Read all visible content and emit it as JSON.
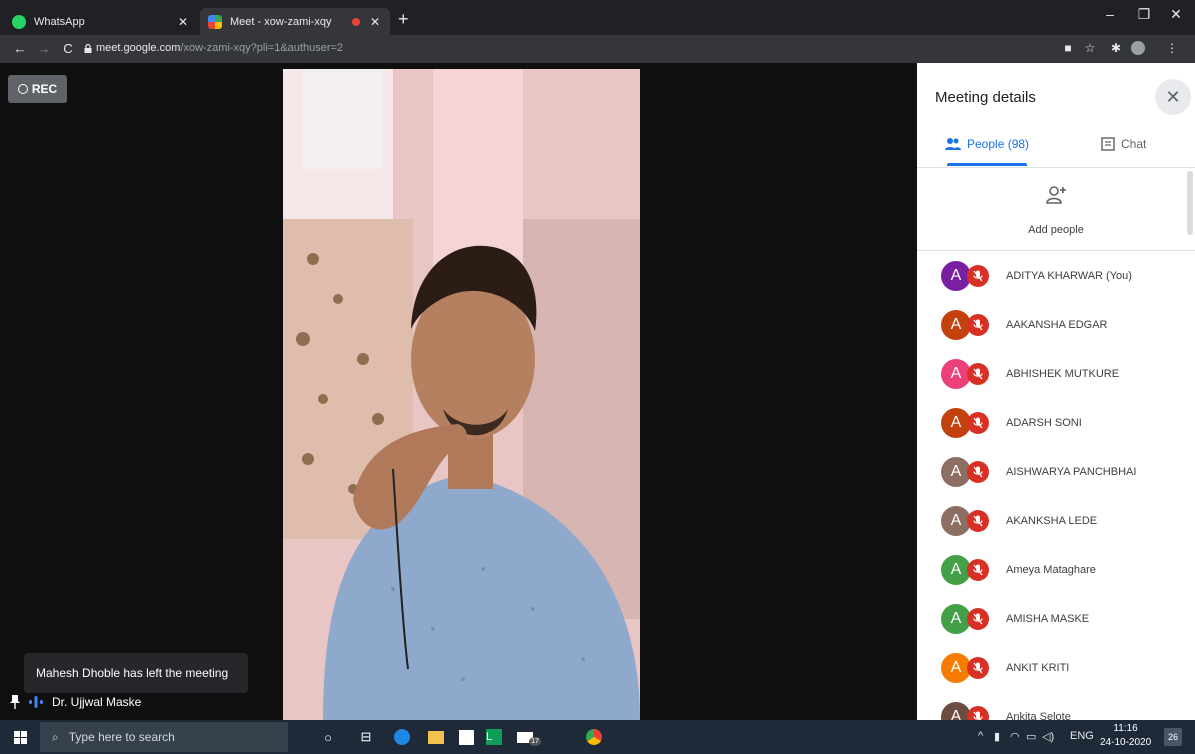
{
  "browser": {
    "tabs": [
      {
        "title": "WhatsApp"
      },
      {
        "title": "Meet - xow-zami-xqy"
      }
    ],
    "url_host": "meet.google.com",
    "url_path": "/xow-zami-xqy?pli=1&authuser=2"
  },
  "meeting": {
    "rec_label": "REC",
    "toast": "Mahesh Dhoble has left the meeting",
    "speaker_name": "Dr. Ujjwal Maske"
  },
  "panel": {
    "title": "Meeting details",
    "people_tab": "People (98)",
    "chat_tab": "Chat",
    "add_people": "Add people",
    "participants": [
      {
        "initial": "A",
        "name": "ADITYA KHARWAR (You)",
        "color": "#7b1fa2"
      },
      {
        "initial": "A",
        "name": "AAKANSHA EDGAR",
        "color": "#c2410c"
      },
      {
        "initial": "A",
        "name": "ABHISHEK MUTKURE",
        "color": "#ec407a"
      },
      {
        "initial": "A",
        "name": "ADARSH SONI",
        "color": "#c2410c"
      },
      {
        "initial": "A",
        "name": "AISHWARYA PANCHBHAI",
        "color": "#8d6e63"
      },
      {
        "initial": "A",
        "name": "AKANKSHA LEDE",
        "color": "#8d6e63"
      },
      {
        "initial": "A",
        "name": "Ameya Mataghare",
        "color": "#43a047"
      },
      {
        "initial": "A",
        "name": "AMISHA MASKE",
        "color": "#43a047"
      },
      {
        "initial": "A",
        "name": "ANKIT KRITI",
        "color": "#f57c00"
      },
      {
        "initial": "A",
        "name": "Ankita Selote",
        "color": "#6d4c41"
      }
    ]
  },
  "taskbar": {
    "search_placeholder": "Type here to search",
    "lang": "ENG",
    "time": "11:16",
    "date": "24-10-2020",
    "notifications": "26",
    "mail_badge": "17"
  },
  "colors": {
    "accent": "#1a73e8",
    "mute_red": "#d93025"
  }
}
